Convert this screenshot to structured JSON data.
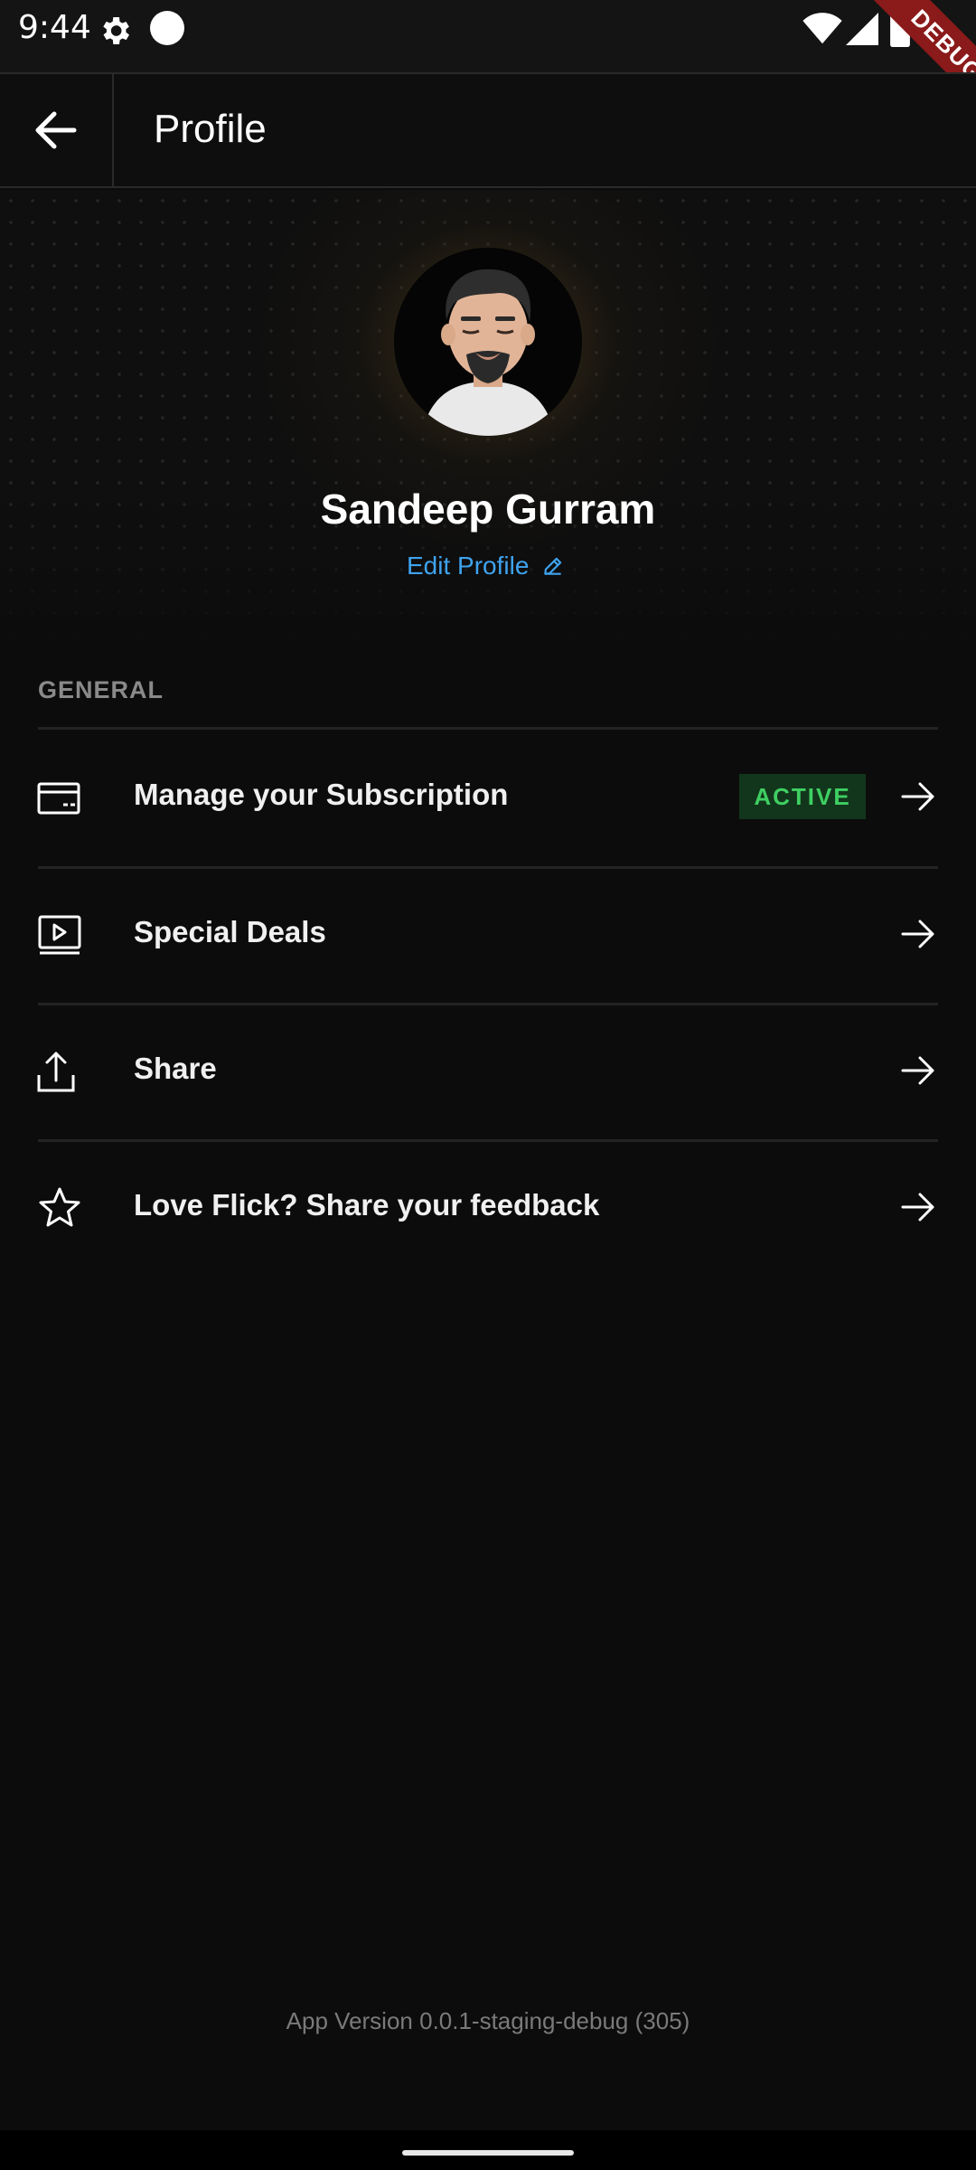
{
  "status_bar": {
    "time": "9:44",
    "icons": [
      "settings-gear-icon",
      "notification-dot-icon",
      "wifi-icon",
      "signal-icon",
      "battery-icon"
    ],
    "debug_label": "DEBUG"
  },
  "app_bar": {
    "back_icon": "arrow-left-icon",
    "title": "Profile"
  },
  "profile": {
    "name": "Sandeep Gurram",
    "edit_label": "Edit Profile",
    "edit_icon": "pencil-icon"
  },
  "general": {
    "section_label": "GENERAL",
    "items": [
      {
        "label": "Manage your Subscription",
        "icon": "card-icon",
        "badge": "ACTIVE"
      },
      {
        "label": "Special Deals",
        "icon": "play-screen-icon"
      },
      {
        "label": "Share",
        "icon": "upload-share-icon"
      },
      {
        "label": "Love Flick? Share your feedback",
        "icon": "star-icon"
      }
    ]
  },
  "footer": {
    "app_version": "App Version 0.0.1-staging-debug (305)"
  },
  "colors": {
    "background": "#0c0c0c",
    "accent_link": "#3fa3ef",
    "badge_bg": "#12361c",
    "badge_text": "#3fcf62",
    "debug_ribbon": "#8b1a1a"
  }
}
